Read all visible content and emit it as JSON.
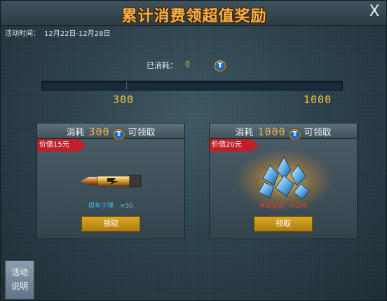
{
  "window": {
    "title": "累计消费领超值奖励",
    "close_label": "X"
  },
  "event": {
    "label": "活动时间：",
    "range": "12月22日-12月28日"
  },
  "progress": {
    "consumed_label": "已消耗：",
    "consumed_value": "0",
    "fraction": 0.0,
    "milestones": [
      "300",
      "1000"
    ]
  },
  "rewards": [
    {
      "cost_prefix": "消耗",
      "cost": "300",
      "cost_suffix": "可领取",
      "value_tag": "价值15元",
      "item_name": "周年子弹",
      "item_qty": "×50",
      "claim_label": "领取",
      "icon": "bullet-icon"
    },
    {
      "cost_prefix": "消耗",
      "cost": "1000",
      "cost_suffix": "可领取",
      "value_tag": "价值20元",
      "item_name": "幸运钻石",
      "item_qty": "×200",
      "claim_label": "领取",
      "icon": "crystal-cluster-icon"
    }
  ],
  "help": {
    "line1": "活动",
    "line2": "说明"
  },
  "colors": {
    "accent": "#f2b441",
    "claim_button": "#c8941a",
    "value_tag": "#c0202a"
  }
}
